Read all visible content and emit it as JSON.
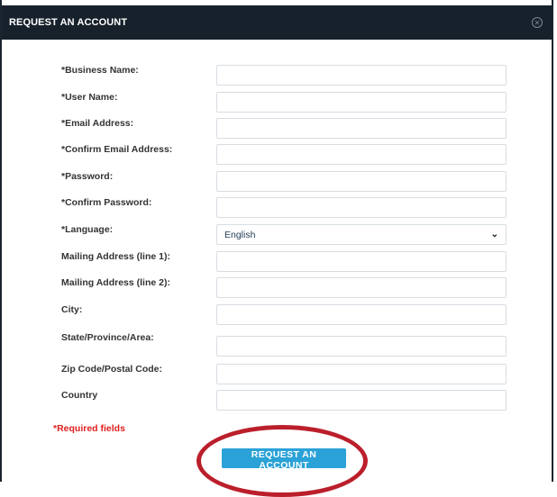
{
  "header": {
    "title": "REQUEST AN ACCOUNT",
    "close_icon": "circle-x-icon"
  },
  "fields": [
    {
      "label": "*Business Name:",
      "value": "",
      "type": "text"
    },
    {
      "label": "*User Name:",
      "value": "",
      "type": "text"
    },
    {
      "label": "*Email Address:",
      "value": "",
      "type": "text"
    },
    {
      "label": "*Confirm Email Address:",
      "value": "",
      "type": "text"
    },
    {
      "label": "*Password:",
      "value": "",
      "type": "password"
    },
    {
      "label": "*Confirm Password:",
      "value": "",
      "type": "password"
    },
    {
      "label": "*Language:",
      "value": "English",
      "type": "select"
    },
    {
      "label": "Mailing Address (line 1):",
      "value": "",
      "type": "text"
    },
    {
      "label": "Mailing Address (line 2):",
      "value": "",
      "type": "text"
    },
    {
      "label": "City:",
      "value": "",
      "type": "text"
    },
    {
      "label": "State/Province/Area:",
      "value": "",
      "type": "text"
    },
    {
      "label": "Zip Code/Postal Code:",
      "value": "",
      "type": "text"
    },
    {
      "label": "Country",
      "value": "",
      "type": "text"
    }
  ],
  "required_note": "*Required fields",
  "submit_label": "REQUEST AN ACCOUNT",
  "colors": {
    "header_bg": "#17212b",
    "button_bg": "#2aa2d7",
    "required_text": "#e02020",
    "annotation_circle": "#bb1f2b"
  }
}
